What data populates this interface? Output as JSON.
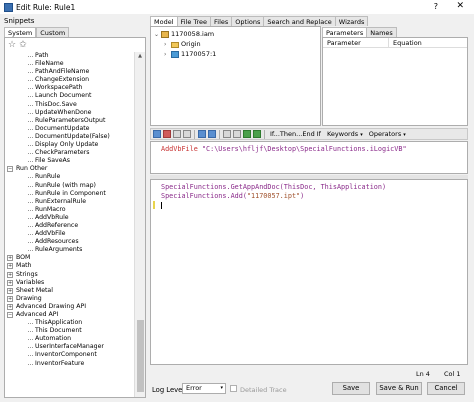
{
  "window": {
    "title": "Edit Rule: Rule1",
    "help_glyph": "?",
    "close_glyph": "✕"
  },
  "snippets": {
    "label": "Snippets",
    "tabs": [
      "System",
      "Custom"
    ],
    "active_tab": "System",
    "tree": [
      {
        "text": "Path",
        "level": "child"
      },
      {
        "text": "FileName",
        "level": "child"
      },
      {
        "text": "PathAndFileName",
        "level": "child"
      },
      {
        "text": "ChangeExtension",
        "level": "child"
      },
      {
        "text": "WorkspacePath",
        "level": "child"
      },
      {
        "text": "Launch Document",
        "level": "child"
      },
      {
        "text": "ThisDoc.Save",
        "level": "child"
      },
      {
        "text": "UpdateWhenDone",
        "level": "child"
      },
      {
        "text": "RuleParametersOutput",
        "level": "child"
      },
      {
        "text": "DocumentUpdate",
        "level": "child"
      },
      {
        "text": "DocumentUpdate(False)",
        "level": "child"
      },
      {
        "text": "Display Only Update",
        "level": "child"
      },
      {
        "text": "CheckParameters",
        "level": "child"
      },
      {
        "text": "File SaveAs",
        "level": "child"
      },
      {
        "text": "Run Other",
        "level": "cat",
        "exp": "−"
      },
      {
        "text": "RunRule",
        "level": "child"
      },
      {
        "text": "RunRule (with map)",
        "level": "child"
      },
      {
        "text": "RunRule in Component",
        "level": "child"
      },
      {
        "text": "RunExternalRule",
        "level": "child"
      },
      {
        "text": "RunMacro",
        "level": "child"
      },
      {
        "text": "AddVbRule",
        "level": "child"
      },
      {
        "text": "AddReference",
        "level": "child"
      },
      {
        "text": "AddVbFile",
        "level": "child"
      },
      {
        "text": "AddResources",
        "level": "child"
      },
      {
        "text": "RuleArguments",
        "level": "child"
      },
      {
        "text": "BOM",
        "level": "cat",
        "exp": "+"
      },
      {
        "text": "Math",
        "level": "cat",
        "exp": "+"
      },
      {
        "text": "Strings",
        "level": "cat",
        "exp": "+"
      },
      {
        "text": "Variables",
        "level": "cat",
        "exp": "+"
      },
      {
        "text": "Sheet Metal",
        "level": "cat",
        "exp": "+"
      },
      {
        "text": "Drawing",
        "level": "cat",
        "exp": "+"
      },
      {
        "text": "Advanced Drawing API",
        "level": "cat",
        "exp": "+"
      },
      {
        "text": "Advanced API",
        "level": "cat",
        "exp": "−"
      },
      {
        "text": "ThisApplication",
        "level": "child"
      },
      {
        "text": "This Document",
        "level": "child"
      },
      {
        "text": "Automation",
        "level": "child"
      },
      {
        "text": "UserInterfaceManager",
        "level": "child"
      },
      {
        "text": "InventorComponent",
        "level": "child"
      },
      {
        "text": "InventorFeature",
        "level": "child"
      }
    ]
  },
  "top_tabs": [
    "Model",
    "File Tree",
    "Files",
    "Options",
    "Search and Replace",
    "Wizards"
  ],
  "model_tree": {
    "root": "1170058.iam",
    "children": [
      "Origin",
      "1170057:1"
    ]
  },
  "parameters": {
    "tabs": [
      "Parameters",
      "Names"
    ],
    "headers": [
      "Parameter",
      "Equation"
    ]
  },
  "toolbar": {
    "if_then": "If...Then...End If",
    "keywords": "Keywords",
    "operators": "Operators",
    "dropdown_glyph": "▾"
  },
  "code_header": {
    "keyword": "AddVbFile",
    "path": "\"C:\\Users\\hfljf\\Desktop\\SpecialFunctions.iLogicVB\""
  },
  "code_main": {
    "line1": "SpecialFunctions.GetAppAndDoc(ThisDoc, ThisApplication)",
    "line2_prefix": "SpecialFunctions.Add(",
    "line2_str": "\"1170057.ipt\"",
    "line2_suffix": ")"
  },
  "status": {
    "ln": "Ln 4",
    "col": "Col 1"
  },
  "bottom": {
    "log_level_label": "Log Level",
    "log_level_value": "Error",
    "detailed_trace": "Detailed Trace",
    "save": "Save",
    "save_run": "Save & Run",
    "cancel": "Cancel"
  }
}
